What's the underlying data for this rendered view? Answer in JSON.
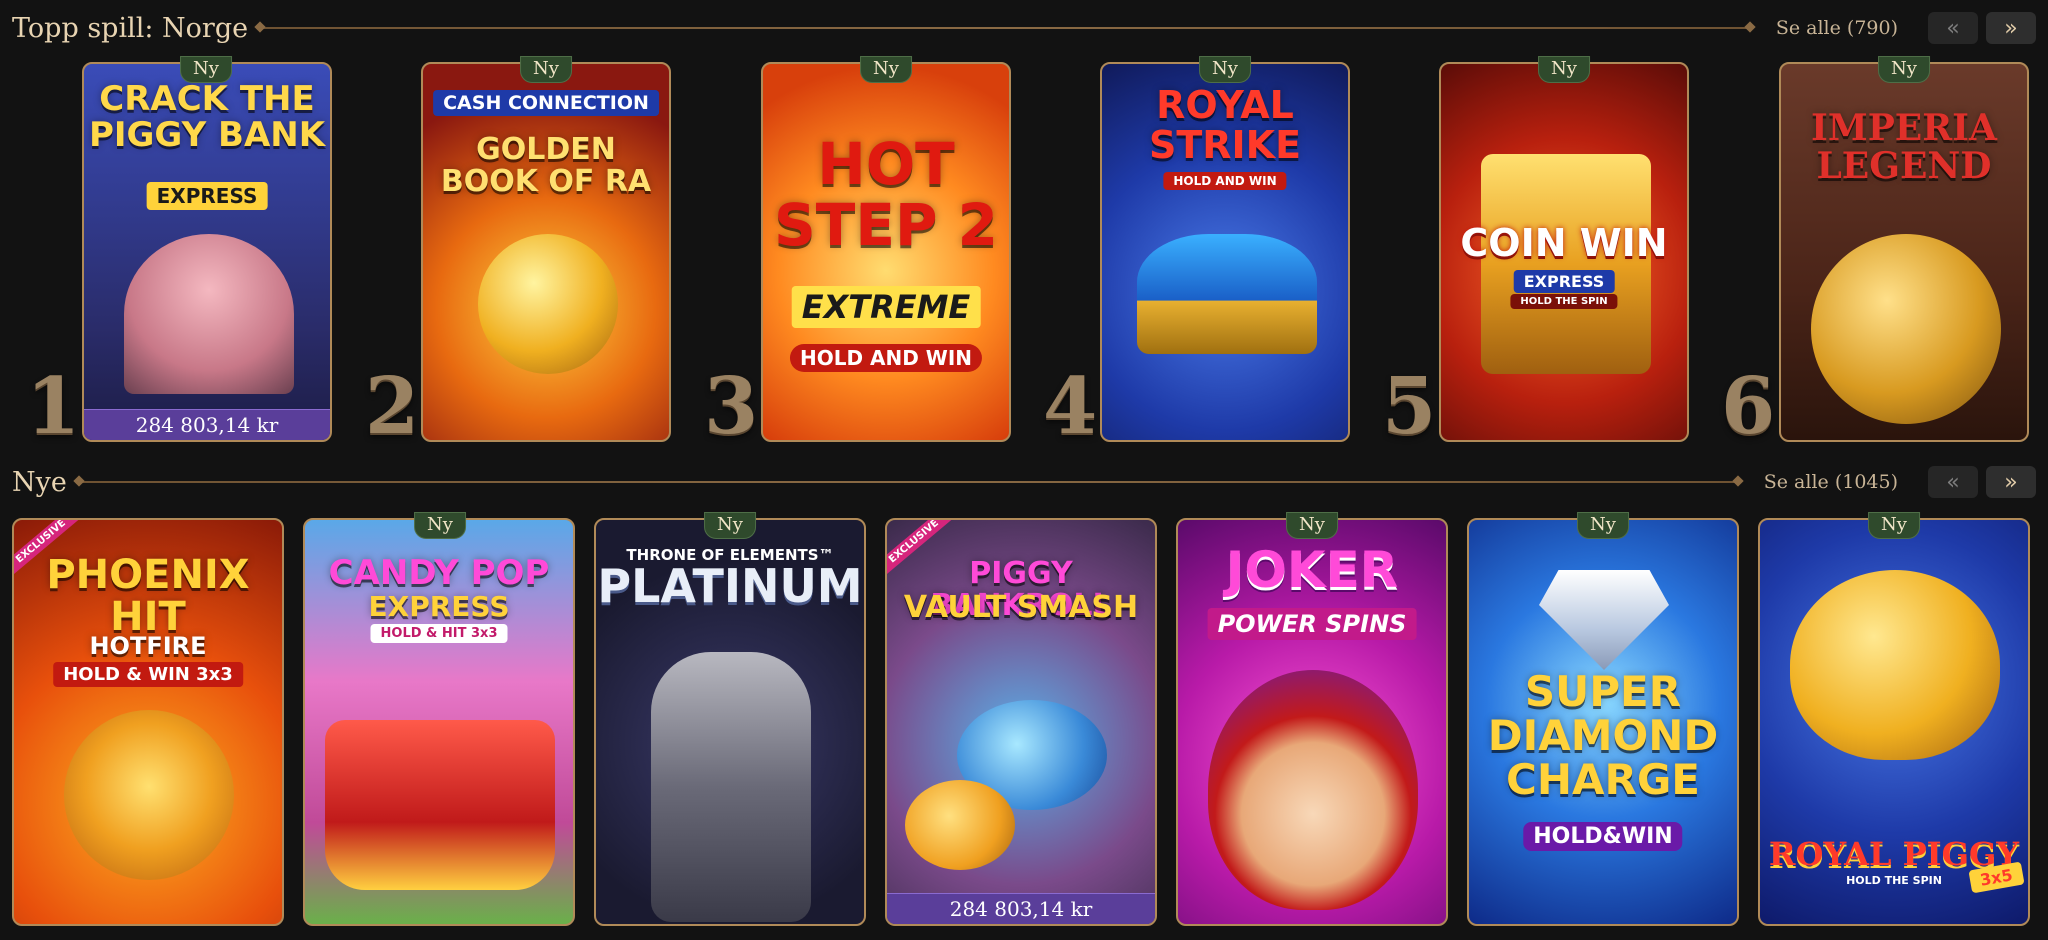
{
  "top_section": {
    "title": "Topp spill: Norge",
    "see_all": "Se alle (790)",
    "prev_icon": "chevron-double-left-icon",
    "next_icon": "chevron-double-right-icon"
  },
  "new_section": {
    "title": "Nye",
    "see_all": "Se alle (1045)",
    "prev_icon": "chevron-double-left-icon",
    "next_icon": "chevron-double-right-icon"
  },
  "badge_label": "Ny",
  "top_games": [
    {
      "rank": "1",
      "title": "CRACK THE PIGGY BANK",
      "subtitle": "EXPRESS",
      "jackpot": "284 803,14 kr",
      "bg": "#2c3a8a"
    },
    {
      "rank": "2",
      "title": "GOLDEN BOOK OF RA",
      "subtitle": "CASH CONNECTION",
      "bg": "#8a1e12"
    },
    {
      "rank": "3",
      "title": "HOT STEP 2",
      "subtitle": "EXTREME",
      "tag": "HOLD AND WIN",
      "bg": "#e25a10"
    },
    {
      "rank": "4",
      "title": "ROYAL STRIKE",
      "subtitle": "HOLD AND WIN",
      "bg": "#1e3aa8"
    },
    {
      "rank": "5",
      "title": "COIN WIN",
      "subtitle": "EXPRESS",
      "tag": "HOLD THE SPIN",
      "bg": "#9a1e10"
    },
    {
      "rank": "6",
      "title": "IMPERIA LEGEND",
      "bg": "#5a2a1c"
    }
  ],
  "new_games": [
    {
      "title": "PHOENIX HIT",
      "subtitle": "HOTFIRE",
      "tag": "HOLD & WIN 3x3",
      "exclusive": "EXCLUSIVE",
      "bg": "#b8300c"
    },
    {
      "title": "CANDY POP",
      "subtitle": "EXPRESS",
      "tag": "HOLD & HIT 3x3",
      "bg": "#c85aa8"
    },
    {
      "title": "PLATINUM",
      "subtitle": "THRONE OF ELEMENTS™",
      "bg": "#2a2a40"
    },
    {
      "title": "PIGGY BANKROLL",
      "subtitle": "VAULT SMASH",
      "exclusive": "EXCLUSIVE",
      "jackpot": "284 803,14 kr",
      "bg": "#7a4a8a"
    },
    {
      "title": "JOKER",
      "subtitle": "POWER SPINS",
      "bg": "#8a1e9a"
    },
    {
      "title": "SUPER DIAMOND CHARGE",
      "subtitle": "HOLD&WIN",
      "bg": "#1850b0"
    },
    {
      "title": "ROYAL PIGGY",
      "subtitle": "3x5",
      "tag": "HOLD THE SPIN",
      "bg": "#2240b8"
    }
  ]
}
